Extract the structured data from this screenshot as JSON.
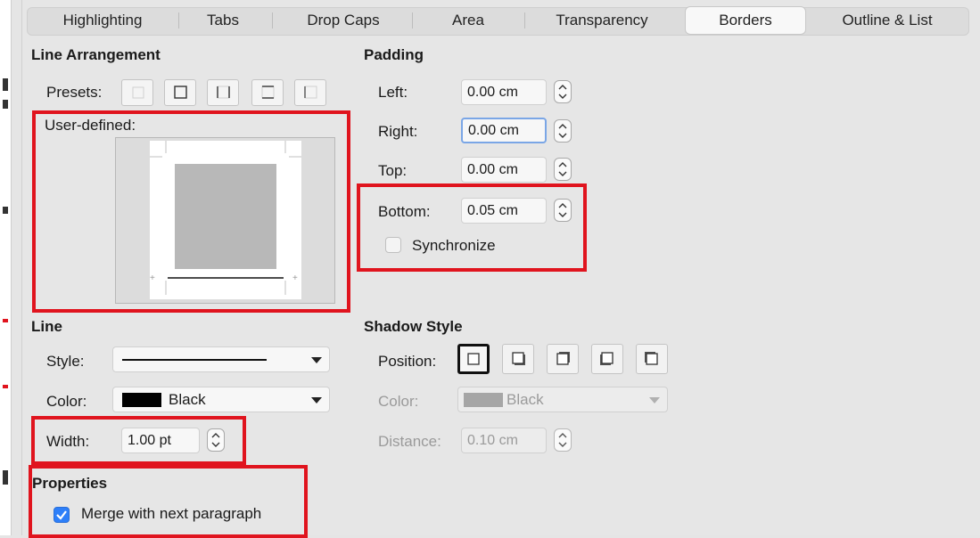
{
  "tabs": [
    {
      "label": "Highlighting"
    },
    {
      "label": "Tabs"
    },
    {
      "label": "Drop Caps"
    },
    {
      "label": "Area"
    },
    {
      "label": "Transparency"
    },
    {
      "label": "Borders"
    },
    {
      "label": "Outline & List"
    }
  ],
  "active_tab": "Borders",
  "line_arrangement": {
    "heading": "Line Arrangement",
    "presets_label": "Presets:",
    "user_defined_label": "User-defined:"
  },
  "padding": {
    "heading": "Padding",
    "left": {
      "label": "Left:",
      "value": "0.00 cm"
    },
    "right": {
      "label": "Right:",
      "value": "0.00 cm"
    },
    "top": {
      "label": "Top:",
      "value": "0.00 cm"
    },
    "bottom": {
      "label": "Bottom:",
      "value": "0.05 cm"
    },
    "synchronize": {
      "label": "Synchronize",
      "checked": false
    }
  },
  "line": {
    "heading": "Line",
    "style_label": "Style:",
    "color_label": "Color:",
    "color_value": "Black",
    "width_label": "Width:",
    "width_value": "1.00 pt"
  },
  "shadow_style": {
    "heading": "Shadow Style",
    "position_label": "Position:",
    "color_label": "Color:",
    "color_value": "Black",
    "distance_label": "Distance:",
    "distance_value": "0.10 cm"
  },
  "properties": {
    "heading": "Properties",
    "merge_label": "Merge with next paragraph",
    "merge_checked": true
  },
  "colors": {
    "highlight_red": "#e0141e",
    "checkbox_blue": "#2d7ff9"
  }
}
